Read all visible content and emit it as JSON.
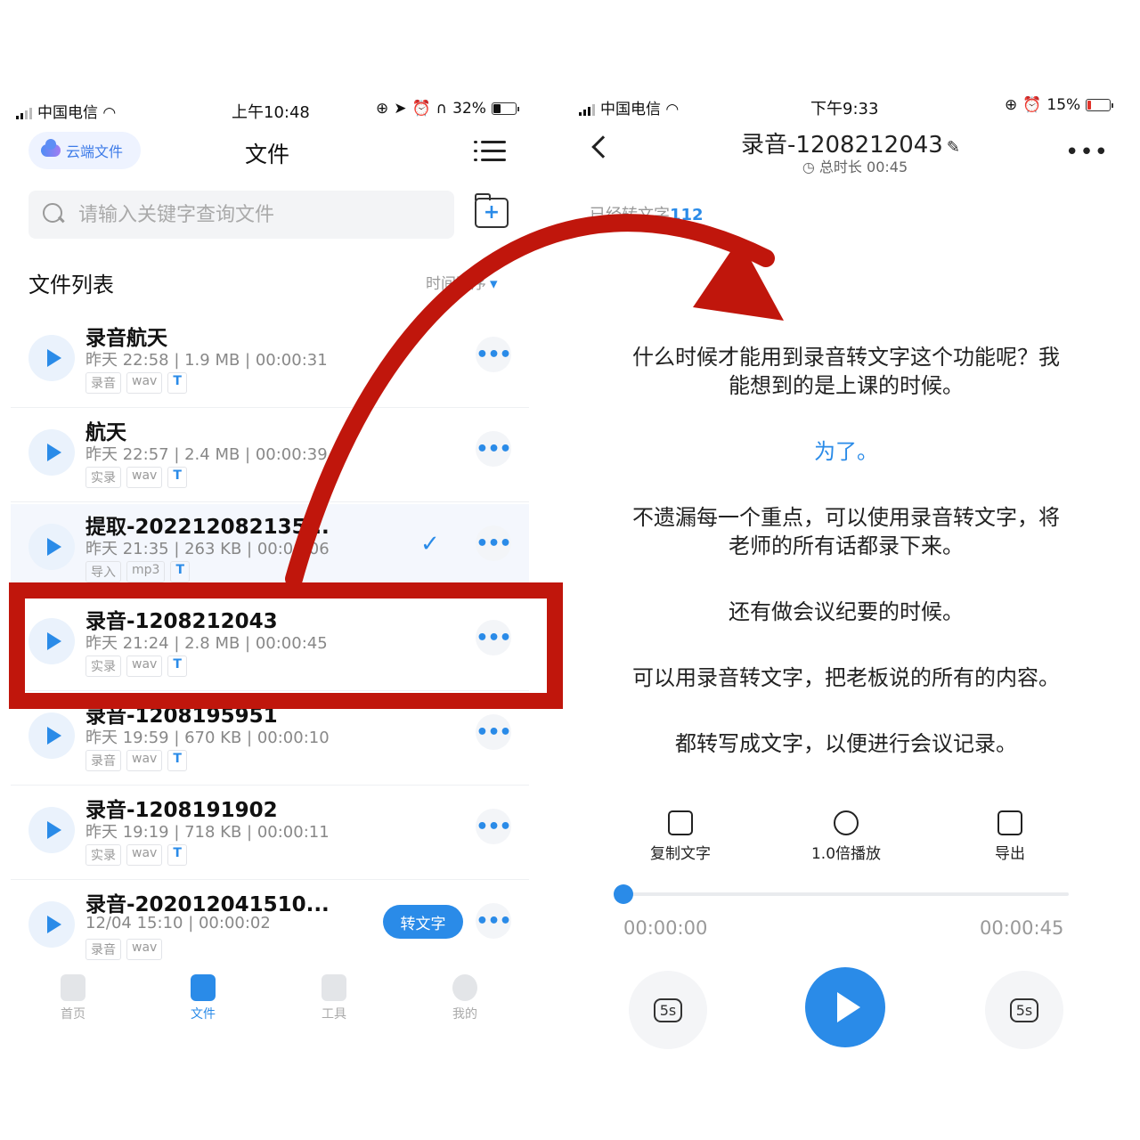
{
  "left": {
    "status": {
      "carrier": "中国电信",
      "time": "上午10:48",
      "battery": "32%"
    },
    "cloud_button": "云端文件",
    "page_title": "文件",
    "search_placeholder": "请输入关键字查询文件",
    "list_title": "文件列表",
    "sort_label": "时间降序",
    "files": [
      {
        "name": "录音航天",
        "meta": "昨天 22:58 | 1.9 MB | 00:00:31",
        "tags": [
          "录音",
          "wav",
          "T"
        ]
      },
      {
        "name": "航天",
        "meta": "昨天 22:57 | 2.4 MB | 00:00:39",
        "tags": [
          "实录",
          "wav",
          "T"
        ]
      },
      {
        "name": "提取-202212082135...",
        "meta": "昨天 21:35 | 263 KB | 00:00:06",
        "tags": [
          "导入",
          "mp3",
          "T"
        ]
      },
      {
        "name": "录音-1208212043",
        "meta": "昨天 21:24 | 2.8 MB | 00:00:45",
        "tags": [
          "实录",
          "wav",
          "T"
        ]
      },
      {
        "name": "录音-1208195951",
        "meta": "昨天 19:59 | 670 KB | 00:00:10",
        "tags": [
          "录音",
          "wav",
          "T"
        ]
      },
      {
        "name": "录音-1208191902",
        "meta": "昨天 19:19 | 718 KB | 00:00:11",
        "tags": [
          "实录",
          "wav",
          "T"
        ]
      },
      {
        "name": "录音-202012041510...",
        "meta": "12/04 15:10 | 00:00:02",
        "tags": [
          "录音",
          "wav"
        ],
        "action": "转文字"
      }
    ],
    "nav": [
      "首页",
      "文件",
      "工具",
      "我的"
    ]
  },
  "right": {
    "status": {
      "carrier": "中国电信",
      "time": "下午9:33",
      "battery": "15%"
    },
    "title": "录音-1208212043",
    "duration_label": "总时长 00:45",
    "converted_label": "已经转文字",
    "converted_count": "112",
    "paragraphs": [
      "什么时候才能用到录音转文字这个功能呢？我能想到的是上课的时候。",
      "为了。",
      "不遗漏每一个重点，可以使用录音转文字，将老师的所有话都录下来。",
      "还有做会议纪要的时候。",
      "可以用录音转文字，把老板说的所有的内容。",
      "都转写成文字，以便进行会议记录。"
    ],
    "tools": [
      "复制文字",
      "1.0倍播放",
      "导出"
    ],
    "time_start": "00:00:00",
    "time_end": "00:00:45",
    "skip_back": "5s",
    "skip_fwd": "5s",
    "progress": 0.0
  },
  "colors": {
    "accent": "#2a8be8",
    "annotation": "#c0160c"
  }
}
